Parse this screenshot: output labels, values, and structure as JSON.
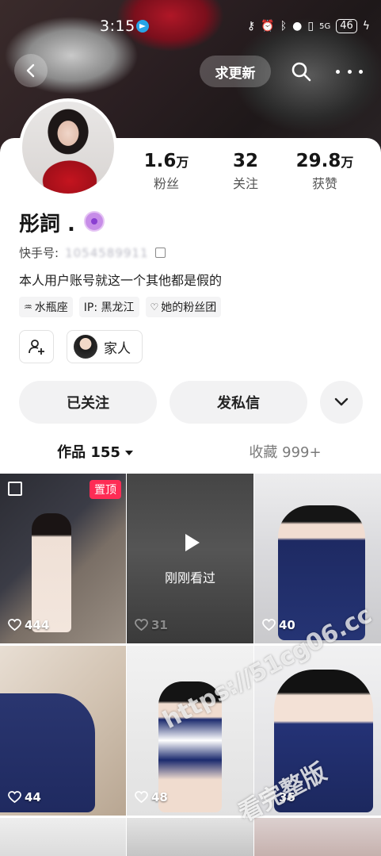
{
  "status": {
    "time": "3:15",
    "battery": "46",
    "network": "5G"
  },
  "header": {
    "ask_update": "求更新"
  },
  "profile": {
    "name": "彤詞 .",
    "kuaishou_label": "快手号:",
    "kuaishou_id": "1054589911",
    "bio": "本人用户账号就这一个其他都是假的",
    "tags": [
      "水瓶座",
      "IP: 黑龙江",
      "她的粉丝团"
    ],
    "family_label": "家人"
  },
  "stats": [
    {
      "num": "1.6",
      "unit": "万",
      "label": "粉丝"
    },
    {
      "num": "32",
      "unit": "",
      "label": "关注"
    },
    {
      "num": "29.8",
      "unit": "万",
      "label": "获赞"
    }
  ],
  "actions": {
    "followed": "已关注",
    "message": "发私信"
  },
  "tabs": {
    "works": "作品 155",
    "collections": "收藏 999+"
  },
  "grid": {
    "pinned_label": "置顶",
    "watched_label": "刚刚看过",
    "likes": [
      "444",
      "31",
      "40",
      "44",
      "48",
      "36"
    ]
  },
  "watermark": {
    "line1": "https://51cg06.cc",
    "line2": "看完整版"
  },
  "colors": {
    "accent": "#fe2c55",
    "badge": "#c78de8"
  }
}
